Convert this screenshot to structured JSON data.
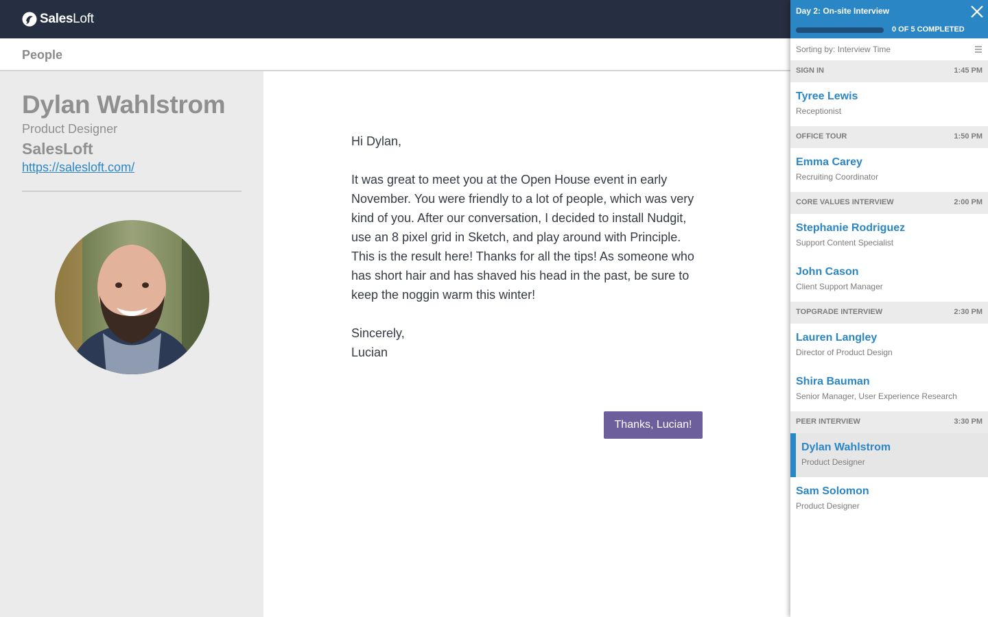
{
  "brand": {
    "name_bold": "Sales",
    "name_regular": "Loft"
  },
  "subheader": {
    "title": "People"
  },
  "profile": {
    "name": "Dylan Wahlstrom",
    "title": "Product Designer",
    "company": "SalesLoft",
    "url": "https://salesloft.com/"
  },
  "letter": {
    "greeting": "Hi Dylan,",
    "body": "It was great to meet you at the Open House event in early November. You were friendly to a lot of people, which was very kind of you. After our conversation, I decided to install Nudgit, use an 8 pixel grid in Sketch, and play around with Principle. This is the result here! Thanks for all the tips! As someone who has short hair and has shaved his head in the past, be sure to keep the noggin warm this winter!",
    "closing": "Sincerely,",
    "signature": "Lucian",
    "button_label": "Thanks, Lucian!"
  },
  "sidebar": {
    "title": "Day 2: On-site Interview",
    "progress_label": "0 OF 5 COMPLETED",
    "progress_fraction": 0.0,
    "sort_label": "Sorting by: Interview Time",
    "sections": [
      {
        "name": "SIGN IN",
        "time": "1:45 PM",
        "people": [
          {
            "name": "Tyree Lewis",
            "role": "Receptionist",
            "active": false
          }
        ]
      },
      {
        "name": "OFFICE TOUR",
        "time": "1:50 PM",
        "people": [
          {
            "name": "Emma Carey",
            "role": "Recruiting Coordinator",
            "active": false
          }
        ]
      },
      {
        "name": "CORE VALUES INTERVIEW",
        "time": "2:00 PM",
        "people": [
          {
            "name": "Stephanie Rodriguez",
            "role": "Support Content Specialist",
            "active": false
          },
          {
            "name": "John Cason",
            "role": "Client Support Manager",
            "active": false
          }
        ]
      },
      {
        "name": "TOPGRADE INTERVIEW",
        "time": "2:30 PM",
        "people": [
          {
            "name": "Lauren Langley",
            "role": "Director of Product Design",
            "active": false
          },
          {
            "name": "Shira Bauman",
            "role": "Senior Manager, User Experience Research",
            "active": false
          }
        ]
      },
      {
        "name": "PEER INTERVIEW",
        "time": "3:30 PM",
        "people": [
          {
            "name": "Dylan Wahlstrom",
            "role": "Product Designer",
            "active": true
          },
          {
            "name": "Sam Solomon",
            "role": "Product Designer",
            "active": false
          }
        ]
      }
    ]
  },
  "colors": {
    "topbar": "#262f41",
    "accent": "#2a86c4",
    "button": "#6c5f9b"
  }
}
